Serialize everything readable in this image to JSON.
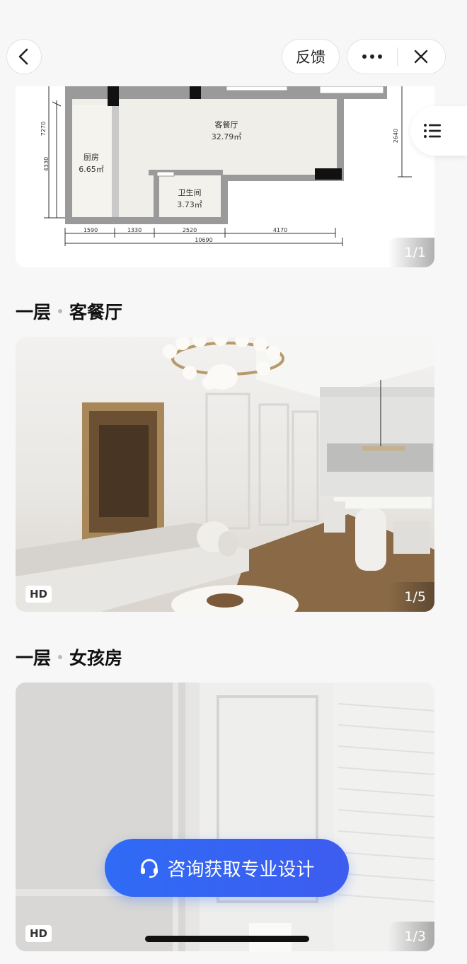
{
  "nav": {
    "feedback_label": "反馈"
  },
  "floorplan": {
    "rooms": [
      {
        "name": "客餐厅",
        "area": "32.79㎡"
      },
      {
        "name": "厨房",
        "area": "6.65㎡"
      },
      {
        "name": "卫生间",
        "area": "3.73㎡"
      }
    ],
    "dims_bottom": [
      "1590",
      "1330",
      "2520",
      "4170"
    ],
    "dim_total": "10690",
    "dims_left": [
      "7270",
      "4330"
    ],
    "dim_right": "2640",
    "counter": "1/1"
  },
  "sections": [
    {
      "floor": "一层",
      "room": "客餐厅",
      "counter": "1/5",
      "badge": "HD"
    },
    {
      "floor": "一层",
      "room": "女孩房",
      "counter": "1/3",
      "badge": "HD"
    }
  ],
  "cta": {
    "label": "咨询获取专业设计"
  },
  "colors": {
    "accent": "#2f6bf5",
    "background": "#f7f7f8"
  }
}
